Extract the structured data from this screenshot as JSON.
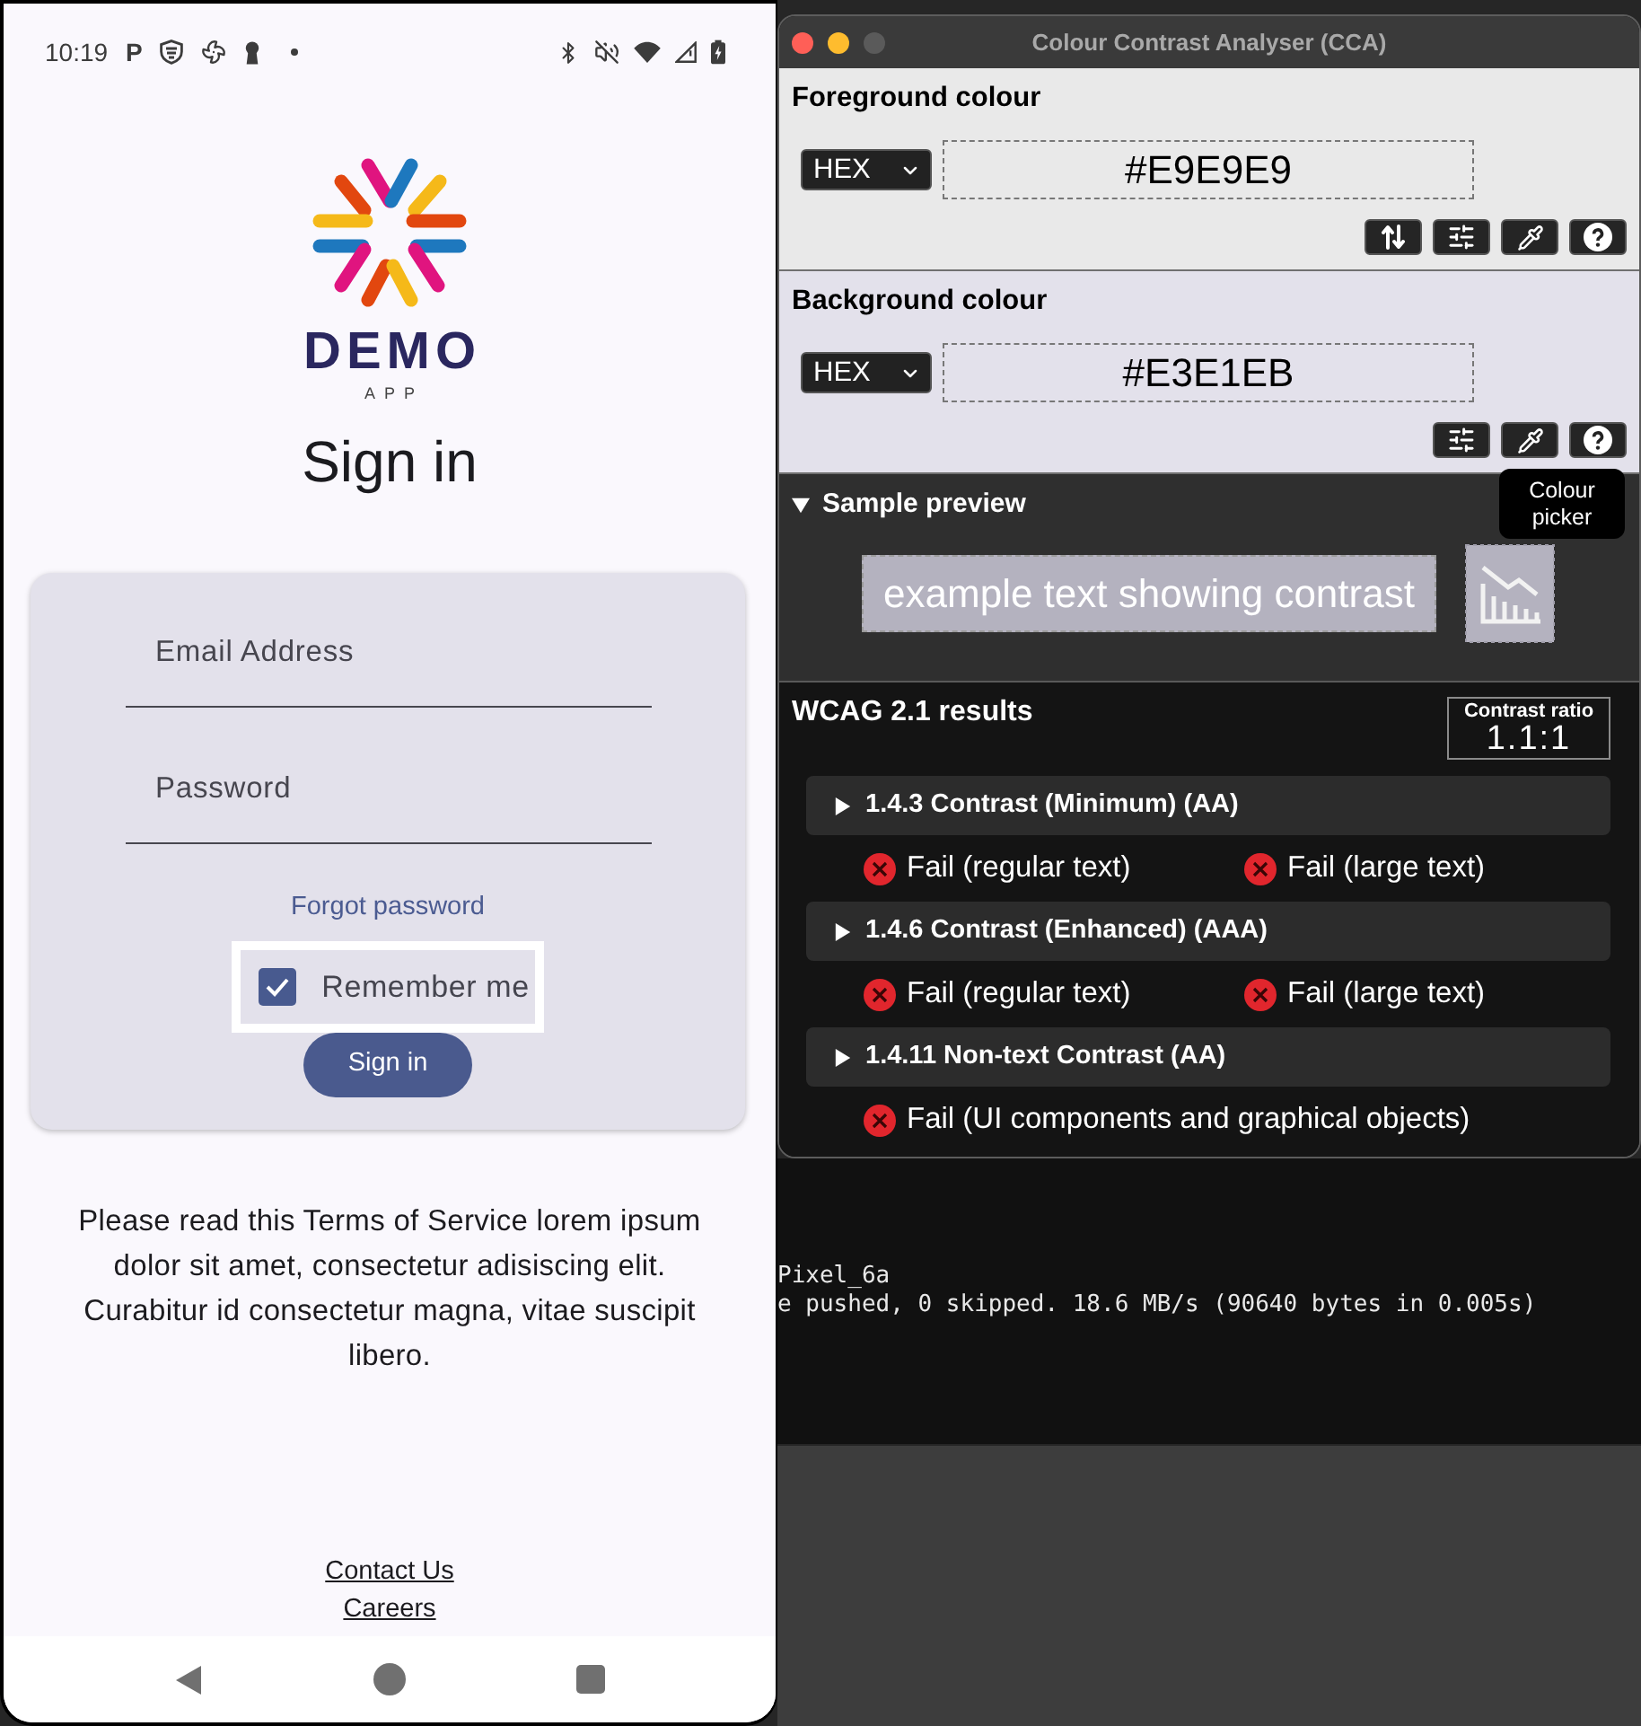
{
  "phone": {
    "status_bar": {
      "time": "10:19",
      "notification_letter": "P"
    },
    "logo": {
      "wordmark": "DEMO",
      "tagline": "APP"
    },
    "title": "Sign in",
    "form": {
      "fields": [
        {
          "placeholder": "Email Address"
        },
        {
          "placeholder": "Password"
        }
      ],
      "forgot_link": "Forgot password",
      "remember": {
        "label": "Remember me",
        "checked": true,
        "highlighted": true
      },
      "submit_button": "Sign in"
    },
    "terms": "Please read this Terms of Service lorem ipsum dolor sit amet, consectetur adisiscing elit. Curabitur id consectetur magna, vitae suscipit libero.",
    "footer_links": [
      "Contact Us",
      "Careers"
    ]
  },
  "cca": {
    "window": {
      "title": "Colour Contrast Analyser (CCA)"
    },
    "colours": [
      {
        "heading": "Foreground colour",
        "format": "HEX",
        "value": "#E9E9E9",
        "tools": [
          {
            "kind": "swap"
          },
          {
            "kind": "sliders"
          },
          {
            "kind": "picker"
          },
          {
            "kind": "help"
          }
        ]
      },
      {
        "heading": "Background colour",
        "format": "HEX",
        "value": "#E3E1EB",
        "tools": [
          {
            "kind": "sliders"
          },
          {
            "kind": "picker"
          },
          {
            "kind": "help"
          }
        ]
      }
    ],
    "tooltip": {
      "text": "Colour picker"
    },
    "sample_preview": {
      "heading": "Sample preview",
      "expanded": true,
      "sample_text": "example text showing contrast"
    },
    "results": {
      "heading": "WCAG 2.1 results",
      "ratio_label": "Contrast ratio",
      "ratio": "1.1:1",
      "criteria": [
        {
          "title": "1.4.3 Contrast (Minimum) (AA)",
          "expanded": false,
          "checks": [
            {
              "label": "Fail (regular text)",
              "passed": false
            },
            {
              "label": "Fail (large text)",
              "passed": false
            }
          ]
        },
        {
          "title": "1.4.6 Contrast (Enhanced) (AAA)",
          "expanded": false,
          "checks": [
            {
              "label": "Fail (regular text)",
              "passed": false
            },
            {
              "label": "Fail (large text)",
              "passed": false
            }
          ]
        },
        {
          "title": "1.4.11 Non-text Contrast (AA)",
          "expanded": false,
          "checks": [
            {
              "label": "Fail (UI components and graphical objects)",
              "passed": false
            }
          ]
        }
      ]
    }
  },
  "terminal": {
    "lines": [
      "Pixel_6a",
      "e pushed, 0 skipped. 18.6 MB/s (90640 bytes in 0.005s)"
    ]
  }
}
